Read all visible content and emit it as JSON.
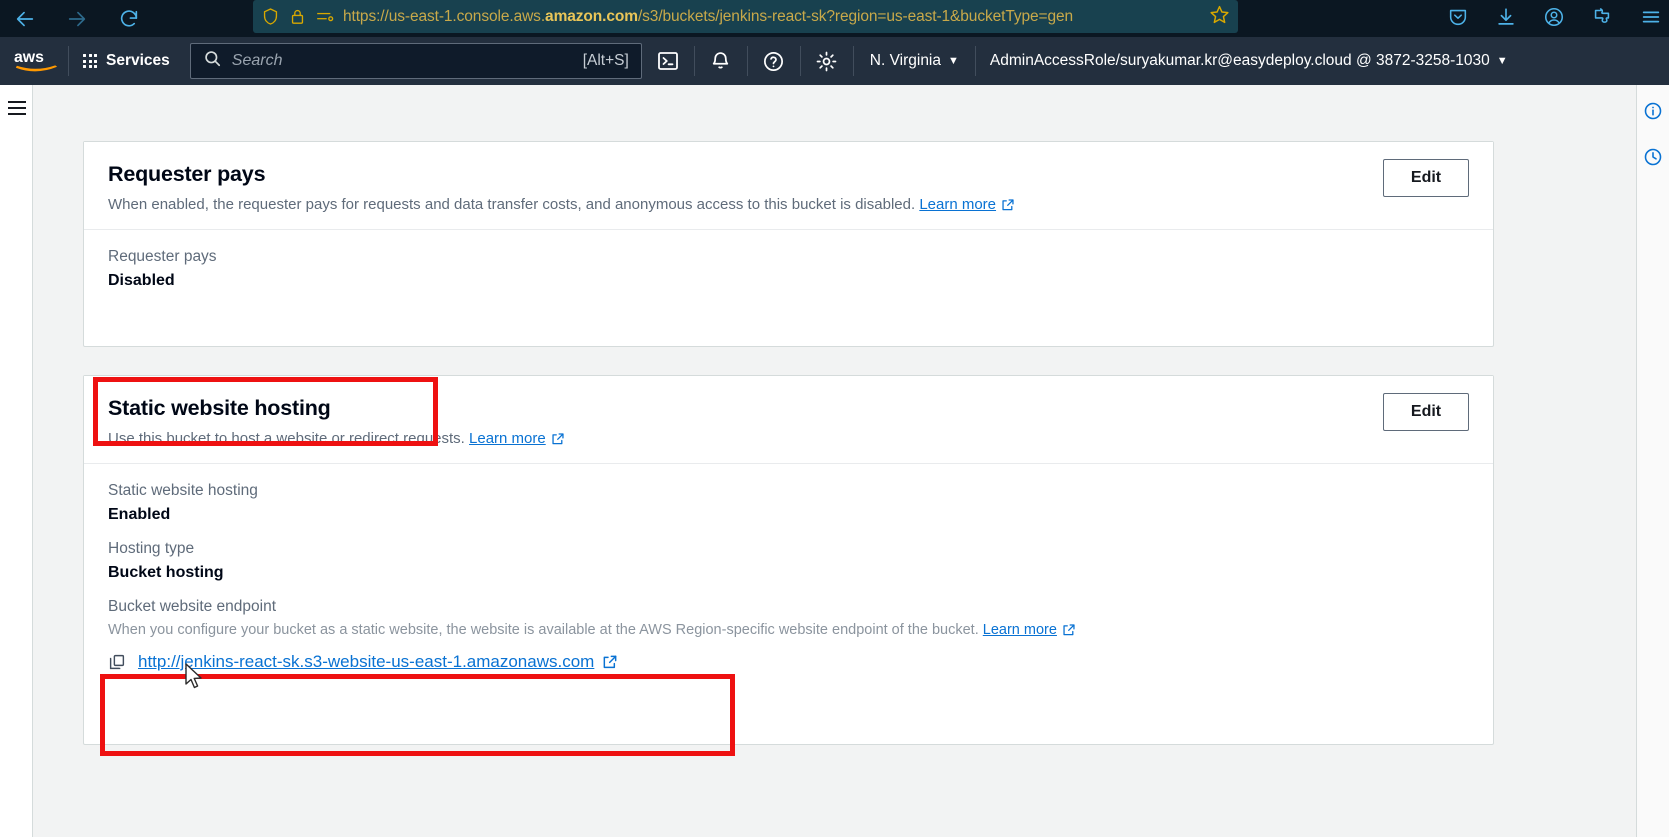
{
  "browser": {
    "back_icon": "back-arrow-icon",
    "forward_icon": "forward-arrow-icon",
    "reload_icon": "reload-icon",
    "shield_icon": "shield-icon",
    "lock_icon": "lock-icon",
    "permissions_icon": "permissions-icon",
    "url_prefix": "https://us-east-1.console.aws.",
    "url_domain": "amazon.com",
    "url_suffix": "/s3/buckets/jenkins-react-sk?region=us-east-1&bucketType=gen",
    "bookmark_icon": "star-icon",
    "right_icons": [
      "pocket-icon",
      "downloads-icon",
      "account-icon",
      "extensions-icon",
      "menu-icon"
    ]
  },
  "aws_nav": {
    "logo": "aws-logo",
    "services_label": "Services",
    "search_placeholder": "Search",
    "search_value": "",
    "search_shortcut": "[Alt+S]",
    "cloudshell_icon": "cloudshell-icon",
    "notifications_icon": "bell-icon",
    "help_icon": "help-icon",
    "settings_icon": "gear-icon",
    "region_label": "N. Virginia",
    "account_label": "AdminAccessRole/suryakumar.kr@easydeploy.cloud @ 3872-3258-1030"
  },
  "left_rail": {
    "menu_icon": "hamburger-menu-icon"
  },
  "right_rail": {
    "info_icon": "info-icon",
    "history_icon": "history-icon"
  },
  "cards": {
    "requester_pays": {
      "title": "Requester pays",
      "description": "When enabled, the requester pays for requests and data transfer costs, and anonymous access to this bucket is disabled.",
      "learn_more": "Learn more",
      "edit_label": "Edit",
      "field_label": "Requester pays",
      "field_value": "Disabled"
    },
    "static_website_hosting": {
      "title": "Static website hosting",
      "description": "Use this bucket to host a website or redirect requests.",
      "learn_more": "Learn more",
      "edit_label": "Edit",
      "hosting_label": "Static website hosting",
      "hosting_value": "Enabled",
      "hosting_type_label": "Hosting type",
      "hosting_type_value": "Bucket hosting",
      "endpoint_label": "Bucket website endpoint",
      "endpoint_note": "When you configure your bucket as a static website, the website is available at the AWS Region-specific website endpoint of the bucket.",
      "endpoint_note_learn_more": "Learn more",
      "endpoint_url": "http://jenkins-react-sk.s3-website-us-east-1.amazonaws.com",
      "copy_icon": "copy-icon",
      "external_link_icon": "external-link-icon"
    }
  },
  "annotations": {
    "title_highlight": "static-website-hosting-title-highlight",
    "url_highlight": "bucket-website-endpoint-highlight",
    "color": "#ee1111"
  },
  "colors": {
    "aws_navy": "#232f3e",
    "link_blue": "#0972d3",
    "page_bg": "#f2f3f3",
    "annotation_red": "#ee1111"
  }
}
